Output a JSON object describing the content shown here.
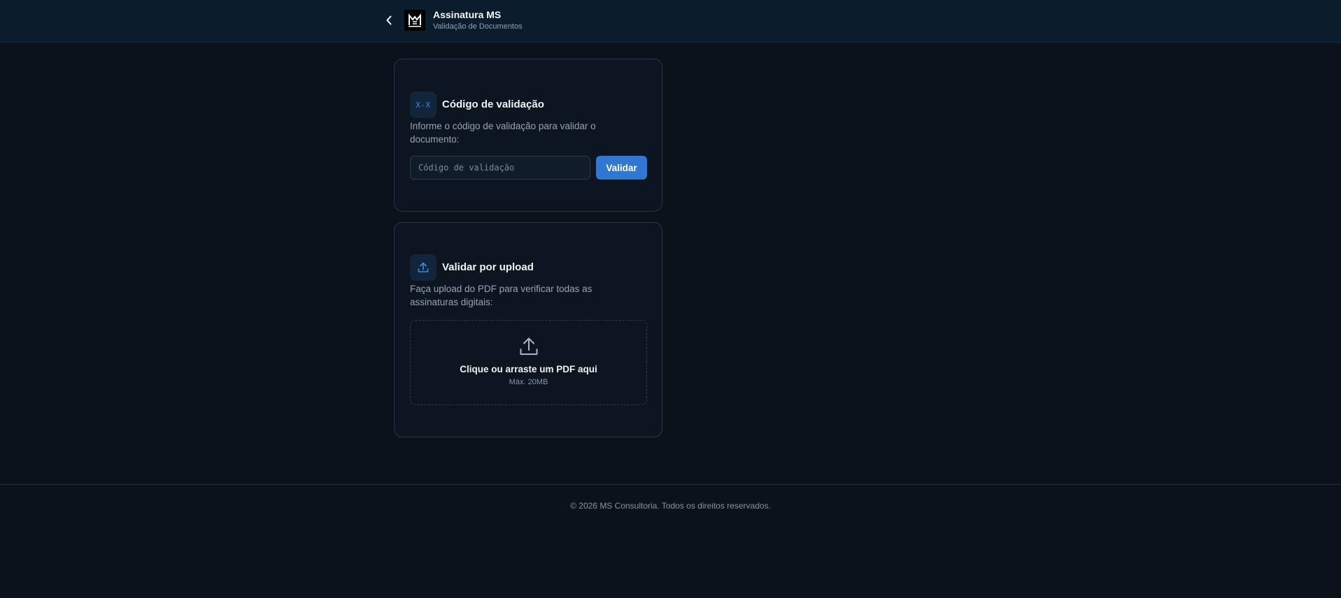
{
  "header": {
    "title": "Assinatura MS",
    "subtitle": "Validação de Documentos",
    "back_icon": "chevron-left-icon",
    "logo_icon": "ms-logo"
  },
  "code_card": {
    "icon_text": "X-X",
    "title": "Código de validação",
    "description": "Informe o código de validação para validar o documento:",
    "input_placeholder": "Código de validação",
    "input_value": "",
    "button_label": "Validar"
  },
  "upload_card": {
    "icon": "upload-icon",
    "title": "Validar por upload",
    "description": "Faça upload do PDF para verificar todas as assinaturas digitais:",
    "dropzone_title": "Clique ou arraste um PDF aqui",
    "dropzone_subtitle": "Máx. 20MB"
  },
  "footer": {
    "text": "© 2026 MS Consultoria. Todos os direitos reservados."
  },
  "colors": {
    "background": "#0b121b",
    "header": "#0b1d2c",
    "accent": "#2f77d1",
    "card": "#0d1520"
  }
}
